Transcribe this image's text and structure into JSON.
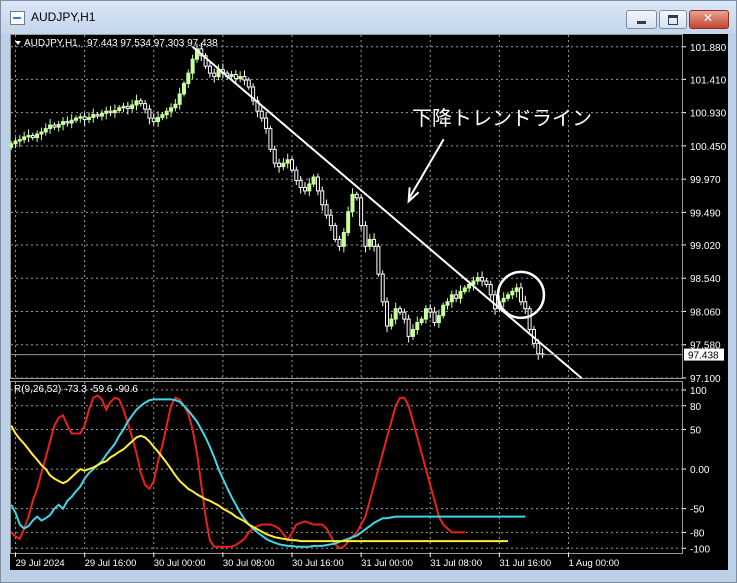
{
  "window": {
    "title": "AUDJPY,H1"
  },
  "colors": {
    "background": "#000000",
    "grid": "#9a9a9a",
    "axis_text": "#ffffff",
    "bull_candle": "#c8ff9a",
    "bear_candle": "#ffffff",
    "trendline": "#ffffff",
    "marker_circle": "#ffffff",
    "rci_short": "#e8221c",
    "rci_mid": "#3fd7e8",
    "rci_long": "#ffee33",
    "price_tag_bg": "#ffffff",
    "price_tag_text": "#000000"
  },
  "chart_data": [
    {
      "type": "candlestick",
      "title": "AUDJPY,H1  97.443 97.534 97.303 97.438",
      "symbol_label": "AUDJPY,H1",
      "ohlc_label": "97.443 97.534 97.303 97.438",
      "ylim": [
        97.1,
        102.05
      ],
      "yticks": [
        "101.880",
        "101.410",
        "100.930",
        "100.450",
        "99.970",
        "99.490",
        "99.020",
        "98.540",
        "98.060",
        "97.580",
        "97.100"
      ],
      "current_price": "97.438",
      "xticks": [
        {
          "bar": 1,
          "label": "29 Jul 2024"
        },
        {
          "bar": 17,
          "label": "29 Jul 16:00"
        },
        {
          "bar": 33,
          "label": "30 Jul 00:00"
        },
        {
          "bar": 49,
          "label": "30 Jul 08:00"
        },
        {
          "bar": 65,
          "label": "30 Jul 16:00"
        },
        {
          "bar": 81,
          "label": "31 Jul 00:00"
        },
        {
          "bar": 97,
          "label": "31 Jul 08:00"
        },
        {
          "bar": 113,
          "label": "31 Jul 16:00"
        },
        {
          "bar": 129,
          "label": "1 Aug 00:00"
        }
      ],
      "closes": [
        100.48,
        100.52,
        100.54,
        100.58,
        100.6,
        100.57,
        100.62,
        100.65,
        100.7,
        100.75,
        100.72,
        100.76,
        100.8,
        100.78,
        100.82,
        100.85,
        100.87,
        100.83,
        100.86,
        100.9,
        100.88,
        100.92,
        100.95,
        100.93,
        100.96,
        101.0,
        101.02,
        100.99,
        101.04,
        101.1,
        101.06,
        100.98,
        100.85,
        100.8,
        100.86,
        100.9,
        100.95,
        101.0,
        101.05,
        101.2,
        101.35,
        101.5,
        101.7,
        101.85,
        101.75,
        101.6,
        101.5,
        101.45,
        101.55,
        101.5,
        101.45,
        101.48,
        101.42,
        101.45,
        101.4,
        101.3,
        101.1,
        100.95,
        100.85,
        100.7,
        100.4,
        100.2,
        100.15,
        100.2,
        100.25,
        100.1,
        99.95,
        99.85,
        99.8,
        99.9,
        100.0,
        99.8,
        99.6,
        99.45,
        99.3,
        99.1,
        99.0,
        99.2,
        99.5,
        99.75,
        99.7,
        99.3,
        99.0,
        99.1,
        99.0,
        98.6,
        98.2,
        97.85,
        97.95,
        98.1,
        98.05,
        97.95,
        97.7,
        97.8,
        97.9,
        97.95,
        98.1,
        98.05,
        97.9,
        98.0,
        98.15,
        98.2,
        98.3,
        98.25,
        98.35,
        98.4,
        98.45,
        98.5,
        98.55,
        98.5,
        98.45,
        98.3,
        98.1,
        98.2,
        98.25,
        98.3,
        98.35,
        98.4,
        98.2,
        98.1,
        97.8,
        97.6,
        97.45,
        97.44
      ],
      "trendline": {
        "from": {
          "bar": 42,
          "price": 101.88
        },
        "to": {
          "bar": 132,
          "price": 97.1
        }
      },
      "marker_circle": {
        "bar": 118,
        "price": 98.3
      },
      "annotation": {
        "text": "下降トレンドライン",
        "arrow_to": {
          "bar": 92,
          "price": 99.65
        }
      }
    },
    {
      "type": "line",
      "title": "R(9,26,52) -73.3 -59.6 -90.6",
      "label": "R(9,26,52) -73.3 -59.6 -90.6",
      "ylim": [
        -106,
        110
      ],
      "yticks": [
        "100",
        "80",
        "50",
        "0.00",
        "-50",
        "-80",
        "-100"
      ],
      "series": [
        {
          "color_key": "rci_short",
          "values": [
            -80,
            -85,
            -88,
            -75,
            -60,
            -40,
            -25,
            -5,
            15,
            35,
            55,
            65,
            68,
            55,
            45,
            45,
            45,
            55,
            75,
            90,
            93,
            88,
            75,
            85,
            90,
            88,
            75,
            58,
            40,
            20,
            -5,
            -20,
            -25,
            -15,
            10,
            30,
            55,
            80,
            90,
            88,
            80,
            70,
            50,
            20,
            -20,
            -60,
            -90,
            -98,
            -98,
            -98,
            -98,
            -98,
            -96,
            -92,
            -88,
            -80,
            -75,
            -72,
            -70,
            -70,
            -70,
            -72,
            -75,
            -82,
            -90,
            -80,
            -70,
            -68,
            -66,
            -68,
            -70,
            -70,
            -70,
            -75,
            -85,
            -95,
            -100,
            -98,
            -92,
            -85,
            -80,
            -70,
            -60,
            -40,
            -20,
            0,
            20,
            40,
            60,
            80,
            90,
            90,
            80,
            60,
            40,
            20,
            0,
            -20,
            -40,
            -60,
            -70,
            -75,
            -80,
            -80,
            -80,
            -80
          ]
        },
        {
          "color_key": "rci_mid",
          "values": [
            -45,
            -55,
            -70,
            -75,
            -72,
            -65,
            -60,
            -65,
            -62,
            -58,
            -50,
            -45,
            -50,
            -40,
            -35,
            -28,
            -22,
            -12,
            -5,
            0,
            5,
            10,
            18,
            25,
            32,
            42,
            50,
            60,
            68,
            75,
            80,
            84,
            87,
            88,
            88,
            88,
            88,
            88,
            87,
            85,
            80,
            74,
            67,
            60,
            50,
            40,
            28,
            15,
            0,
            -12,
            -24,
            -35,
            -45,
            -55,
            -63,
            -70,
            -75,
            -80,
            -84,
            -88,
            -91,
            -93,
            -95,
            -96,
            -97,
            -97,
            -98,
            -98,
            -98,
            -98,
            -97,
            -97,
            -97,
            -96,
            -95,
            -94,
            -92,
            -90,
            -88,
            -86,
            -84,
            -80,
            -76,
            -72,
            -68,
            -65,
            -62,
            -62,
            -61,
            -60,
            -60,
            -60,
            -60,
            -60,
            -60,
            -60,
            -60,
            -60,
            -60,
            -60,
            -60,
            -60,
            -60,
            -60,
            -60,
            -60,
            -60,
            -60,
            -60,
            -60,
            -60,
            -60,
            -60,
            -60,
            -60,
            -60,
            -60,
            -60,
            -60,
            -60
          ]
        },
        {
          "color_key": "rci_long",
          "values": [
            55,
            45,
            38,
            32,
            25,
            18,
            12,
            5,
            0,
            -8,
            -12,
            -15,
            -18,
            -15,
            -10,
            -5,
            0,
            -2,
            0,
            2,
            5,
            8,
            10,
            15,
            18,
            22,
            25,
            30,
            35,
            40,
            42,
            40,
            35,
            28,
            22,
            15,
            8,
            0,
            -8,
            -15,
            -20,
            -25,
            -28,
            -32,
            -35,
            -38,
            -40,
            -43,
            -46,
            -50,
            -53,
            -56,
            -60,
            -63,
            -66,
            -70,
            -73,
            -76,
            -79,
            -82,
            -84,
            -86,
            -87,
            -88,
            -89,
            -90,
            -90,
            -91,
            -91,
            -91,
            -91,
            -91,
            -91,
            -91,
            -91,
            -91,
            -91,
            -91,
            -91,
            -91,
            -91,
            -91,
            -91,
            -91,
            -91,
            -91,
            -91,
            -91,
            -91,
            -91,
            -91,
            -91,
            -91,
            -91,
            -91,
            -91,
            -91,
            -91,
            -91,
            -91,
            -91,
            -91,
            -91,
            -91,
            -91,
            -91,
            -91,
            -91,
            -91,
            -91,
            -91,
            -91,
            -91,
            -91,
            -91,
            -91
          ]
        }
      ]
    }
  ]
}
